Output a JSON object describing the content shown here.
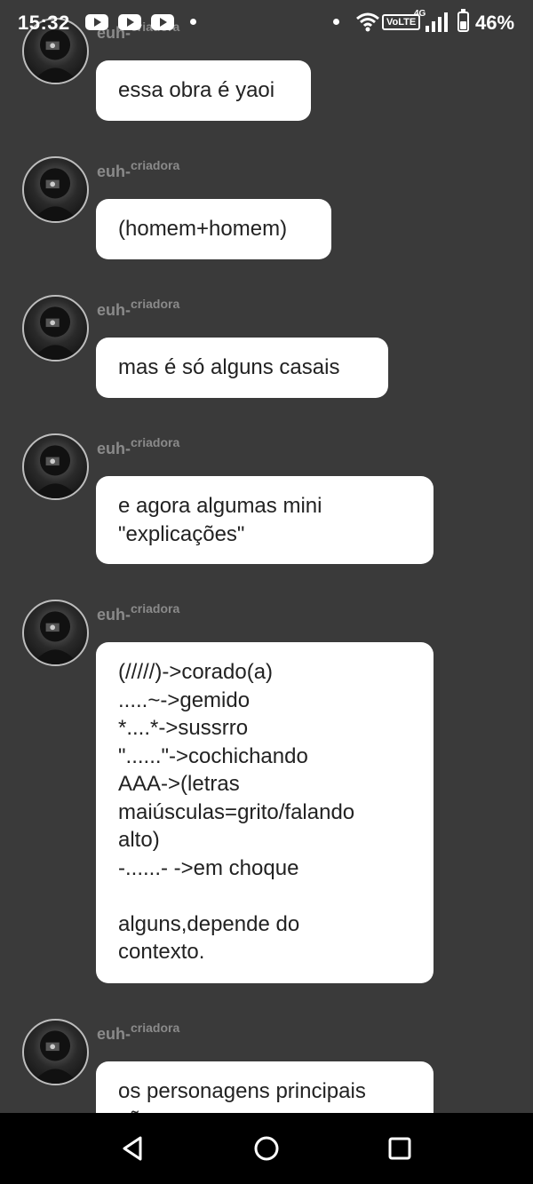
{
  "status_bar": {
    "time": "15:32",
    "network_label": "4G",
    "volte_label": "VoLTE",
    "battery_text": "46%",
    "icons": [
      "youtube-icon",
      "youtube-icon",
      "youtube-icon",
      "dot-icon",
      "dot-icon",
      "wifi-icon",
      "volte-icon",
      "signal-icon",
      "battery-icon"
    ]
  },
  "messages": [
    {
      "username": "euh-",
      "user_suffix": "criadora",
      "text": "essa obra é yaoi"
    },
    {
      "username": "euh-",
      "user_suffix": "criadora",
      "text": "(homem+homem)"
    },
    {
      "username": "euh-",
      "user_suffix": "criadora",
      "text": "mas é só alguns casais"
    },
    {
      "username": "euh-",
      "user_suffix": "criadora",
      "text": "e agora algumas mini\n\"explicações\""
    },
    {
      "username": "euh-",
      "user_suffix": "criadora",
      "text": "(/////)->corado(a)\n.....~->gemido\n*....*->sussrro\n\"......\"->cochichando\nAAA->(letras\nmaiúsculas=grito/falando\nalto)\n-......- ->em choque\n\n  alguns,depende do\ncontexto."
    },
    {
      "username": "euh-",
      "user_suffix": "criadora",
      "text": "os personagens principais\nsão"
    }
  ],
  "colors": {
    "background": "#3a3a3a",
    "bubble": "#ffffff",
    "username": "#8a8a8a",
    "nav_bar": "#000000"
  },
  "nav_bar": {
    "icons": [
      "back-icon",
      "home-icon",
      "recents-icon"
    ]
  }
}
